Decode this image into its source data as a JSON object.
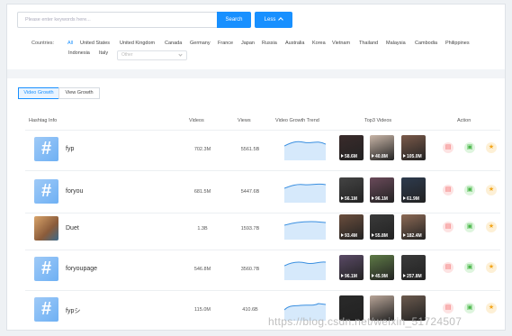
{
  "search": {
    "placeholder": "Please enter keywords here...",
    "button": "Search",
    "less": "Less"
  },
  "filters": {
    "label": "Countries:",
    "countries": [
      "All",
      "United States",
      "United Kingdom",
      "Canada",
      "Germany",
      "France",
      "Japan",
      "Russia",
      "Australia",
      "Korea",
      "Vietnam",
      "Thailand",
      "Malaysia",
      "Cambodia",
      "Philippines",
      "Indonesia",
      "Italy"
    ],
    "active": "All",
    "other_placeholder": "Other"
  },
  "tabs": [
    "Video Growth",
    "View Growth"
  ],
  "table": {
    "headers": [
      "Hashtag Info",
      "Videos",
      "Views",
      "Video Growth Trend",
      "Top3 Videos",
      "Action"
    ],
    "rows": [
      {
        "tag": "fyp",
        "videos": "702.3M",
        "views": "5561.5B",
        "top3": [
          "58.6M",
          "40.8M",
          "105.0M"
        ],
        "photo": false
      },
      {
        "tag": "foryou",
        "videos": "681.5M",
        "views": "5447.6B",
        "top3": [
          "56.1M",
          "96.1M",
          "61.9M"
        ],
        "photo": false
      },
      {
        "tag": "Duet",
        "videos": "1.3B",
        "views": "1593.7B",
        "top3": [
          "93.4M",
          "55.8M",
          "182.4M"
        ],
        "photo": true
      },
      {
        "tag": "foryoupage",
        "videos": "546.8M",
        "views": "3560.7B",
        "top3": [
          "96.1M",
          "45.9M",
          "257.8M"
        ],
        "photo": false
      },
      {
        "tag": "fypシ",
        "videos": "115.0M",
        "views": "410.6B",
        "top3": [
          "",
          "",
          ""
        ],
        "photo": false
      }
    ]
  },
  "colors": {
    "accent": "#1890ff"
  },
  "icons": {
    "tag": "hashtag-icon",
    "actions": [
      "chart-icon",
      "shop-icon",
      "star-icon"
    ]
  },
  "watermark": "https://blog.csdn.net/weixin_51724507"
}
